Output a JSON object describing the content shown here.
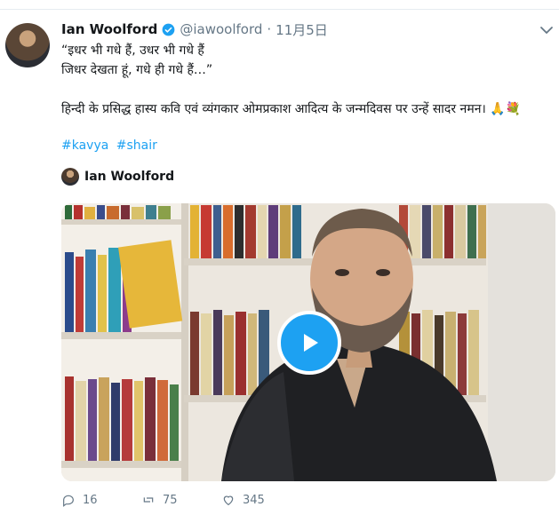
{
  "tweet": {
    "author_name": "Ian Woolford",
    "handle": "@iawoolford",
    "separator": "·",
    "date": "11月5日",
    "lines": [
      "“इधर भी गधे हैं, उधर भी गधे हैं",
      "जिधर देखता हूं, गधे ही गधे हैं…”",
      "हिन्दी के प्रसिद्ध हास्य कवि एवं व्यंगकार ओमप्रकाश आदित्य के जन्मदिवस पर उन्हें सादर नमन। 🙏💐"
    ],
    "hashtags": [
      "#kavya",
      "#shair"
    ],
    "embedded_author": "Ian Woolford"
  },
  "actions": {
    "reply_count": "16",
    "retweet_count": "75",
    "like_count": "345"
  },
  "icons": {
    "verified": "verified-badge-icon",
    "caret": "chevron-down-icon",
    "play": "play-icon",
    "reply": "reply-icon",
    "retweet": "retweet-icon",
    "like": "heart-icon"
  },
  "colors": {
    "accent": "#1da1f2",
    "muted": "#657786",
    "text": "#14171a"
  }
}
